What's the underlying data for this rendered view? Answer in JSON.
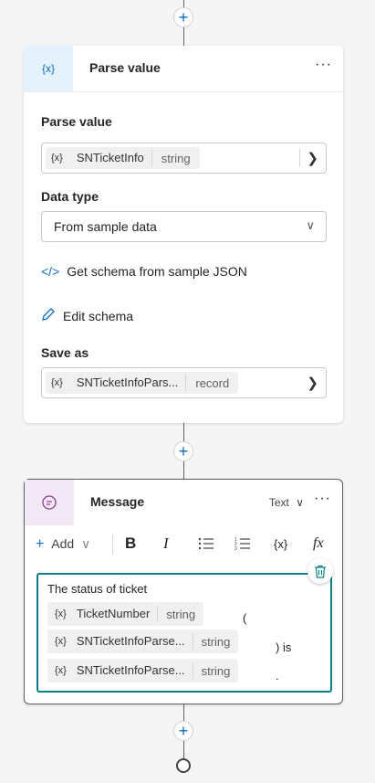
{
  "parse_node": {
    "icon": "variable-icon",
    "icon_text": "{x}",
    "title": "Parse value",
    "more": "···",
    "parse_label": "Parse value",
    "parse_chip": {
      "icon_text": "{x}",
      "name": "SNTicketInfo",
      "type": "string"
    },
    "data_type_label": "Data type",
    "data_type_value": "From sample data",
    "get_schema_icon_text": "</>",
    "get_schema_link": "Get schema from sample JSON",
    "edit_schema_link": "Edit schema",
    "save_as_label": "Save as",
    "save_as_chip": {
      "icon_text": "{x}",
      "name": "SNTicketInfoPars...",
      "type": "record"
    }
  },
  "message_node": {
    "icon": "chat-bubble-icon",
    "title": "Message",
    "mode": "Text",
    "more": "···",
    "toolbar": {
      "add_label": "Add",
      "bold": "B",
      "italic": "I",
      "var_text": "{x}",
      "fx_text": "fx"
    },
    "body": {
      "text_before": "The status of ticket",
      "chips": [
        {
          "icon_text": "{x}",
          "name": "TicketNumber",
          "type": "string",
          "suffix": "("
        },
        {
          "icon_text": "{x}",
          "name": "SNTicketInfoParse...",
          "type": "string",
          "suffix": ") is"
        },
        {
          "icon_text": "{x}",
          "name": "SNTicketInfoParse...",
          "type": "string",
          "suffix": "."
        }
      ]
    }
  },
  "colors": {
    "accent": "#0f6cbd",
    "focus_border": "#0b7f87",
    "parse_icon_bg": "#e6f2fb",
    "message_icon_bg": "#f3e8f5"
  }
}
